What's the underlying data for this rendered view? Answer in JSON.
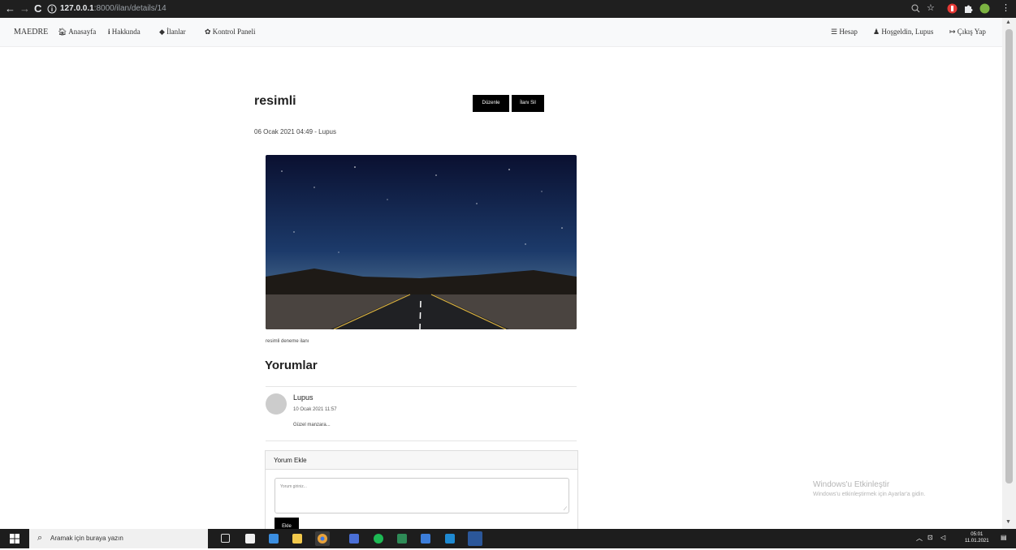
{
  "browser": {
    "back": "←",
    "forward": "→",
    "reload": "C",
    "url_host": "127.0.0.1",
    "url_rest": ":8000/ilan/details/14"
  },
  "navbar": {
    "brand": "MAEDRE",
    "home": "Anasayfa",
    "about": "Hakkında",
    "listings": "İlanlar",
    "panel": "Kontrol Paneli",
    "account": "Hesap",
    "welcome": "Hoşgeldin, Lupus",
    "logout": "Çıkış Yap"
  },
  "post": {
    "title": "resimli",
    "edit_label": "Düzenle",
    "delete_label": "İlanı Sil",
    "meta": "06 Ocak 2021 04:49 - Lupus",
    "description": "resimli deneme ilanı"
  },
  "comments": {
    "heading": "Yorumlar",
    "items": [
      {
        "author": "Lupus",
        "date": "10 Ocak 2021 11:57",
        "text": "Güzel manzara..."
      }
    ]
  },
  "comment_form": {
    "heading": "Yorum Ekle",
    "placeholder": "Yorum giriniz...",
    "submit_label": "Ekle"
  },
  "watermark": {
    "title": "Windows'u Etkinleştir",
    "subtitle": "Windows'u etkinleştirmek için Ayarlar'a gidin."
  },
  "taskbar": {
    "search_placeholder": "Aramak için buraya yazın",
    "time": "05:01",
    "date": "11.01.2021"
  },
  "colors": {
    "button_bg": "#000000",
    "navbar_bg": "#f8f9fa",
    "browser_bar": "#1f1f1f",
    "taskbar": "#1d1d1d"
  }
}
